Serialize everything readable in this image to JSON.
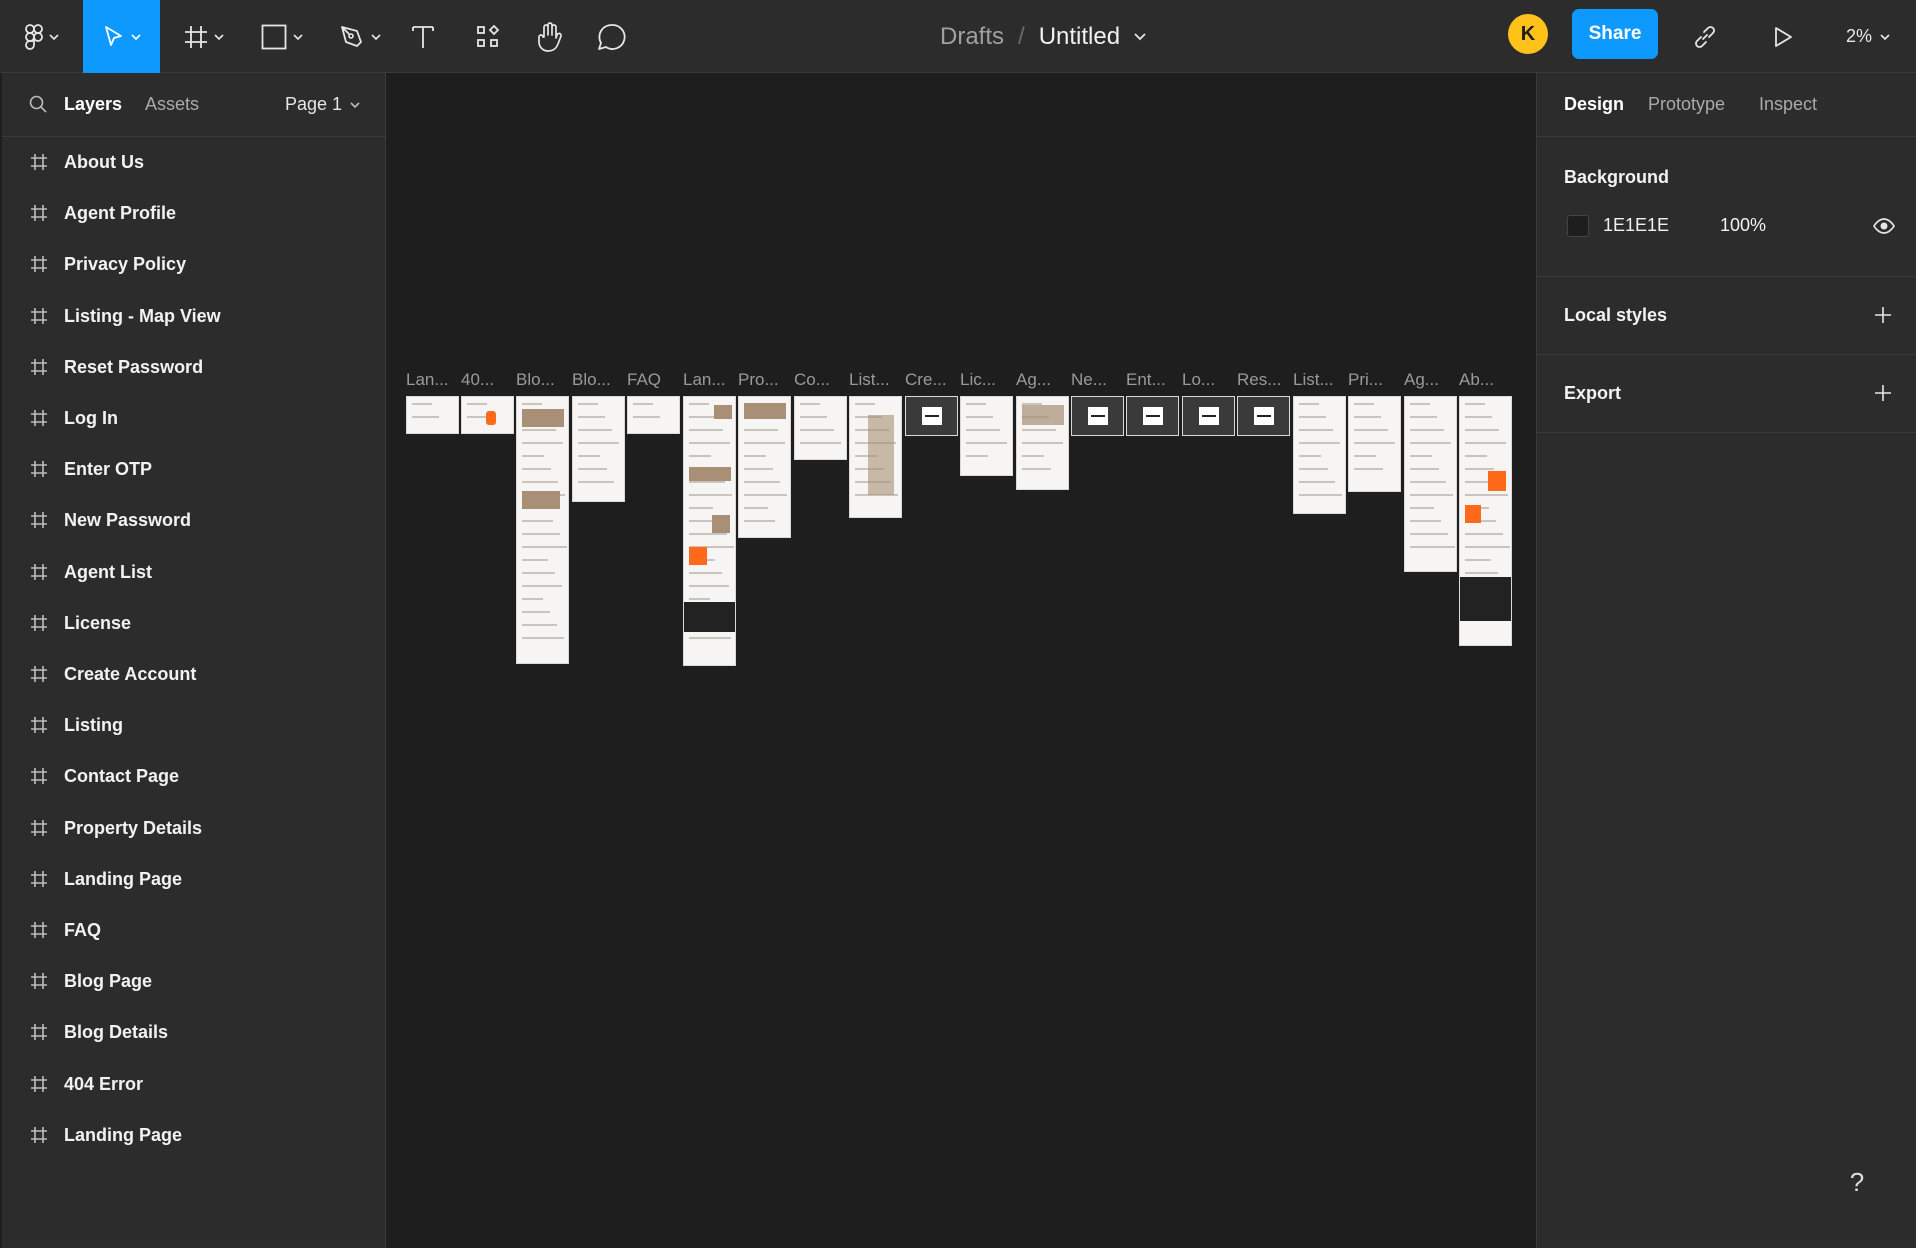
{
  "toolbar": {
    "breadcrumb": "Drafts",
    "separator": "/",
    "file_name": "Untitled",
    "avatar_initial": "K",
    "share_label": "Share",
    "zoom": "2%"
  },
  "left_panel": {
    "tabs": [
      "Layers",
      "Assets"
    ],
    "page": "Page 1",
    "layers": [
      "About Us",
      "Agent Profile",
      "Privacy Policy",
      "Listing - Map View",
      "Reset Password",
      "Log In",
      "Enter OTP",
      "New Password",
      "Agent List",
      "License",
      "Create Account",
      "Listing",
      "Contact Page",
      "Property Details",
      "Landing Page",
      "FAQ",
      "Blog Page",
      "Blog Details",
      "404 Error",
      "Landing Page"
    ]
  },
  "right_panel": {
    "tabs": [
      "Design",
      "Prototype",
      "Inspect"
    ],
    "background_title": "Background",
    "background_hex": "1E1E1E",
    "background_opacity": "100%",
    "local_styles_title": "Local styles",
    "export_title": "Export"
  },
  "canvas": {
    "frame_labels": [
      "Lan...",
      "40...",
      "Blo...",
      "Blo...",
      "FAQ",
      "Lan...",
      "Pro...",
      "Co...",
      "List...",
      "Cre...",
      "Lic...",
      "Ag...",
      "Ne...",
      "Ent...",
      "Lo...",
      "Res...",
      "List...",
      "Pri...",
      "Ag...",
      "Ab..."
    ]
  },
  "help_label": "?",
  "colors": {
    "accent": "#0d99ff",
    "avatar": "#ffc21a",
    "canvas": "#1e1e1e",
    "panel": "#2c2c2c"
  }
}
